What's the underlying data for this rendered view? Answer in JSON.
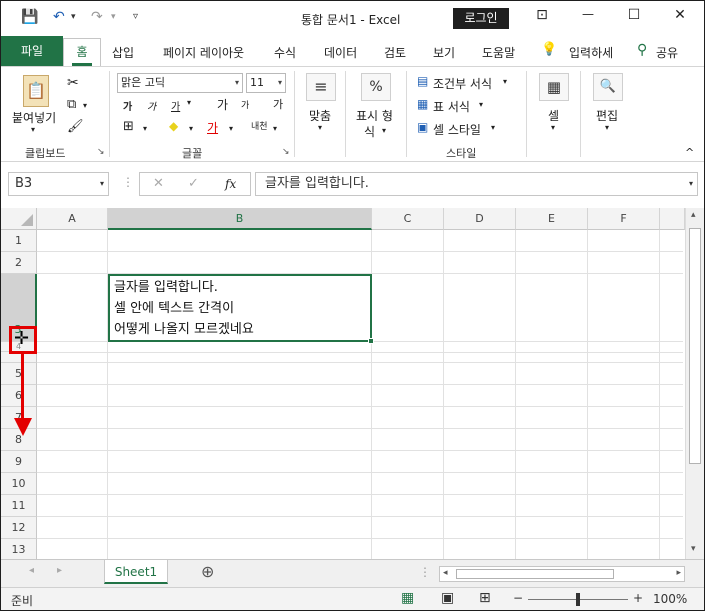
{
  "window": {
    "title": "통합 문서1  -  Excel",
    "login_label": "로그인",
    "minimize": "—",
    "restore": "☐",
    "close": "✕",
    "ribbon_display": "⊡"
  },
  "qat": {
    "save": "💾",
    "undo": "↶",
    "undo_dd": "▾",
    "redo": "↷",
    "redo_dd": "▾",
    "customize": "▿"
  },
  "tabs": {
    "file": "파일",
    "home": "홈",
    "insert": "삽입",
    "layout": "페이지 레이아웃",
    "formulas": "수식",
    "data": "데이터",
    "review": "검토",
    "view": "보기",
    "help": "도움말",
    "tell_me_icon": "💡",
    "tell_me": "입력하세",
    "share_icon": "⚲",
    "share": "공유"
  },
  "ribbon": {
    "clipboard": {
      "label": "클립보드",
      "paste": "붙여넣기",
      "paste_dd": "▾",
      "cut": "✂",
      "copy": "⧉",
      "copy_dd": "▾",
      "format_painter": "🖌"
    },
    "font": {
      "label": "글꼴",
      "name": "맑은 고딕",
      "size": "11",
      "grow": "가",
      "shrink": "가",
      "bold": "가",
      "italic": "가",
      "underline": "가",
      "phonetic": "가",
      "border": "⊞",
      "fill": "◆",
      "font_color": "가",
      "wrap": "내천",
      "dd": "▾"
    },
    "alignment": {
      "label": "맞춤",
      "icon": "≡"
    },
    "number": {
      "label1": "표시 형",
      "label2": "식",
      "icon": "%"
    },
    "styles": {
      "label": "스타일",
      "conditional": "조건부 서식",
      "table": "표 서식",
      "cell_styles": "셀 스타일"
    },
    "cells": {
      "label": "셀",
      "icon": "▦"
    },
    "editing": {
      "label": "편집",
      "icon": "🔍"
    },
    "dd": "▾",
    "launcher": "↘",
    "collapse": "^"
  },
  "formula_bar": {
    "name_box": "B3",
    "cancel": "✕",
    "enter": "✓",
    "fx": "fx",
    "content": "글자를 입력합니다.",
    "dd": "▾"
  },
  "grid": {
    "columns": [
      "A",
      "B",
      "C",
      "D",
      "E",
      "F"
    ],
    "rows": [
      "1",
      "2",
      "3",
      "4",
      "5",
      "6",
      "7",
      "8",
      "9",
      "10",
      "11",
      "12",
      "13"
    ],
    "cell_b3_lines": [
      "글자를 입력합니다.",
      "셀 안에 텍스트 간격이",
      "어떻게 나올지 모르겠네요"
    ],
    "resize_cursor": "✛"
  },
  "sheets": {
    "prev": "◂",
    "next": "▸",
    "tab": "Sheet1",
    "add": "⊕",
    "more": "⋮"
  },
  "scroll": {
    "up": "▴",
    "down": "▾",
    "left": "◂",
    "right": "▸"
  },
  "status": {
    "ready": "준비",
    "normal_view": "▦",
    "page_layout_view": "▣",
    "page_break_view": "⊞",
    "zoom_out": "−",
    "zoom_in": "+",
    "zoom": "100%"
  },
  "colors": {
    "accent": "#217346",
    "annotation": "#e30000"
  }
}
